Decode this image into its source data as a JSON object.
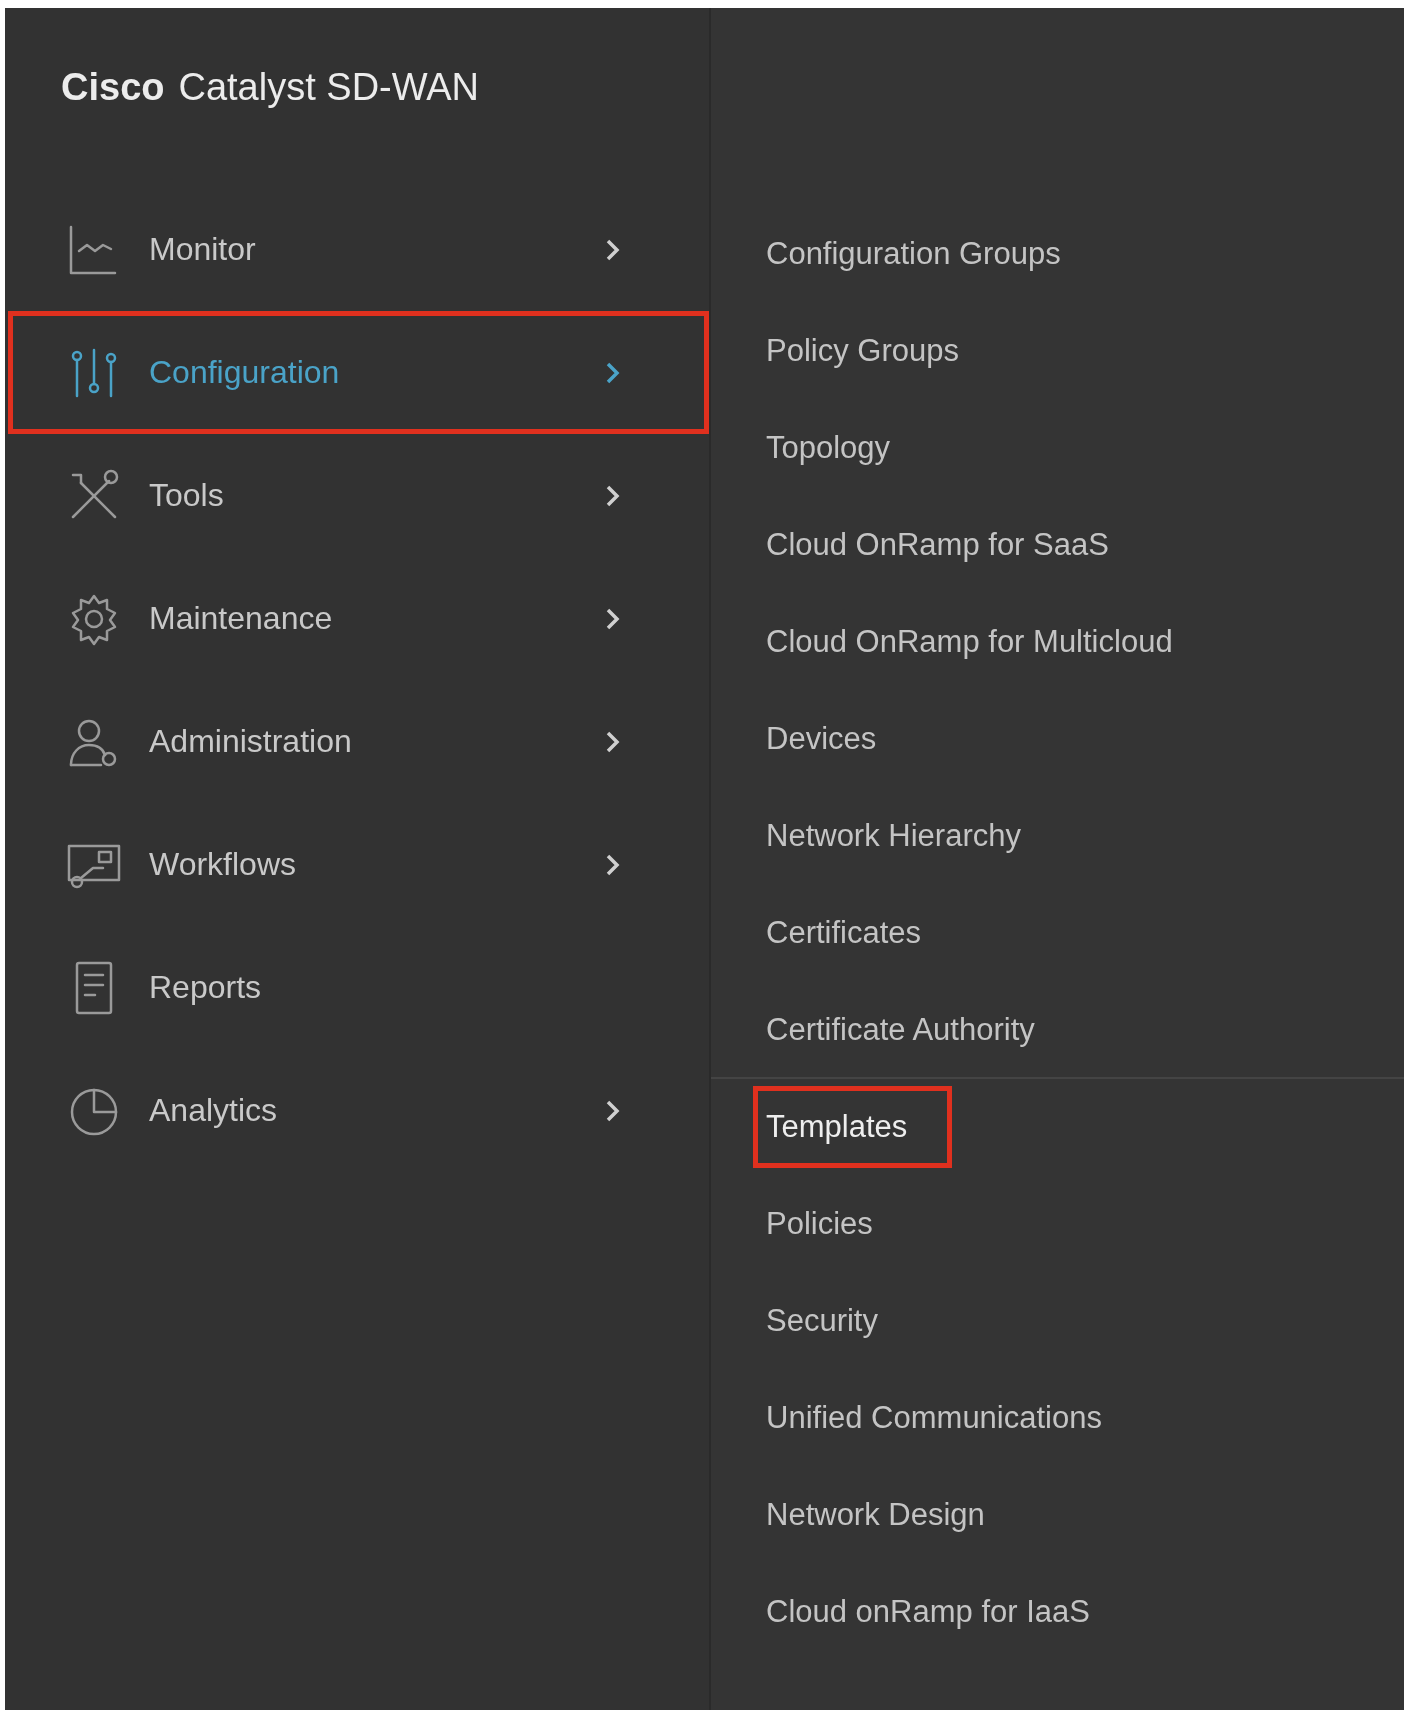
{
  "brand": {
    "name": "Cisco",
    "product": "Catalyst SD-WAN"
  },
  "menu": [
    {
      "label": "Monitor",
      "chevron": true,
      "selected": false,
      "highlighted": false
    },
    {
      "label": "Configuration",
      "chevron": true,
      "selected": true,
      "highlighted": true
    },
    {
      "label": "Tools",
      "chevron": true,
      "selected": false,
      "highlighted": false
    },
    {
      "label": "Maintenance",
      "chevron": true,
      "selected": false,
      "highlighted": false
    },
    {
      "label": "Administration",
      "chevron": true,
      "selected": false,
      "highlighted": false
    },
    {
      "label": "Workflows",
      "chevron": true,
      "selected": false,
      "highlighted": false
    },
    {
      "label": "Reports",
      "chevron": false,
      "selected": false,
      "highlighted": false
    },
    {
      "label": "Analytics",
      "chevron": true,
      "selected": false,
      "highlighted": false
    }
  ],
  "submenu": [
    {
      "label": "Configuration Groups",
      "highlighted": false,
      "divider_before": false
    },
    {
      "label": "Policy Groups",
      "highlighted": false,
      "divider_before": false
    },
    {
      "label": "Topology",
      "highlighted": false,
      "divider_before": false
    },
    {
      "label": "Cloud OnRamp for SaaS",
      "highlighted": false,
      "divider_before": false
    },
    {
      "label": "Cloud OnRamp for Multicloud",
      "highlighted": false,
      "divider_before": false
    },
    {
      "label": "Devices",
      "highlighted": false,
      "divider_before": false
    },
    {
      "label": "Network Hierarchy",
      "highlighted": false,
      "divider_before": false
    },
    {
      "label": "Certificates",
      "highlighted": false,
      "divider_before": false
    },
    {
      "label": "Certificate Authority",
      "highlighted": false,
      "divider_before": false
    },
    {
      "label": "Templates",
      "highlighted": true,
      "divider_before": true
    },
    {
      "label": "Policies",
      "highlighted": false,
      "divider_before": false
    },
    {
      "label": "Security",
      "highlighted": false,
      "divider_before": false
    },
    {
      "label": "Unified Communications",
      "highlighted": false,
      "divider_before": false
    },
    {
      "label": "Network Design",
      "highlighted": false,
      "divider_before": false
    },
    {
      "label": "Cloud onRamp for IaaS",
      "highlighted": false,
      "divider_before": false
    }
  ]
}
